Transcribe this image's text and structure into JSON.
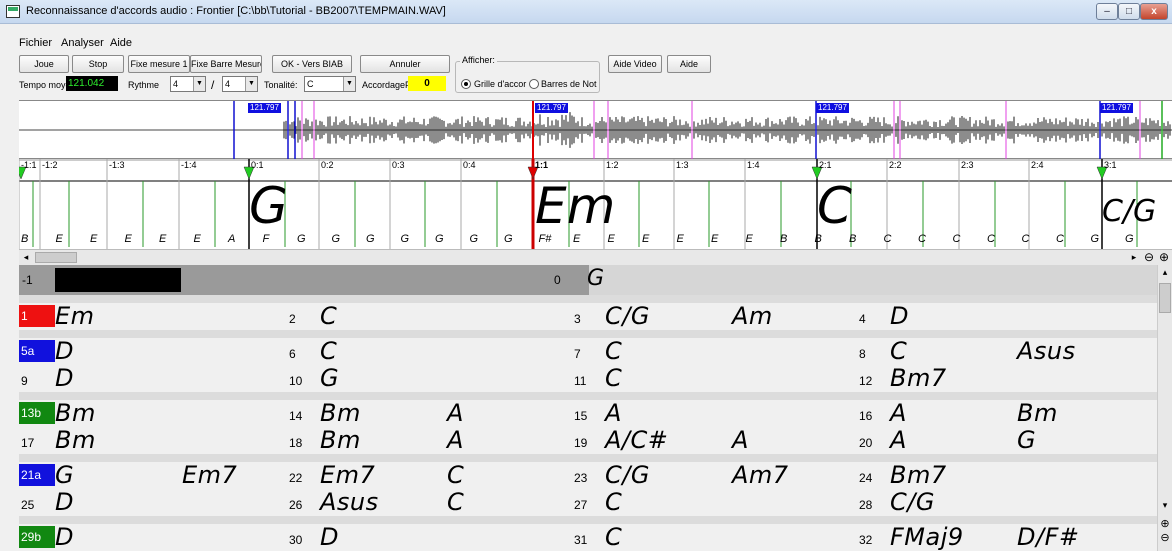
{
  "window": {
    "title": "Reconnaissance d'accords audio : Frontier [C:\\bb\\Tutorial - BB2007\\TEMPMAIN.WAV]",
    "btn_min": "–",
    "btn_max": "□",
    "btn_close": "x"
  },
  "menu": {
    "file": "Fichier",
    "analyze": "Analyser",
    "help": "Aide"
  },
  "toolbar": {
    "play": "Joue",
    "stop": "Stop",
    "fix_bar1": "Fixe mesure 1",
    "fix_barlines": "Fixe Barre Mesure",
    "ok_biab": "OK - Vers BIAB",
    "cancel": "Annuler",
    "display_group": "Afficher:",
    "help_video": "Aide Video",
    "help": "Aide",
    "tempo_label": "Tempo moyen",
    "tempo_value": "121.042",
    "rhythm_label": "Rythme",
    "rhythm_num": "4",
    "rhythm_slash": "/",
    "rhythm_den": "4",
    "key_label": "Tonalité:",
    "key_value": "C",
    "tuning_label": "AccordageF",
    "tuning_value": "0",
    "radio_grid": "Grille d'accor",
    "radio_bars": "Barres de Not"
  },
  "waveform": {
    "tempo_markers": [
      "121.797",
      "121.797",
      "121.797",
      "121.797"
    ]
  },
  "ruler": {
    "beat_labels": [
      "-1:1",
      "-1:2",
      "-1:3",
      "-1:4",
      "0:1",
      "0:2",
      "0:3",
      "0:4",
      "1:1",
      "1:2",
      "1:3",
      "1:4",
      "2:1",
      "2:2",
      "2:3",
      "2:4",
      "3:1"
    ],
    "chords": [
      "G",
      "Em",
      "C",
      "C/G"
    ],
    "notes": [
      "B",
      "E",
      "E",
      "E",
      "E",
      "E",
      "A",
      "F",
      "G",
      "G",
      "G",
      "G",
      "G",
      "G",
      "G",
      "F#",
      "E",
      "E",
      "E",
      "E",
      "E",
      "E",
      "B",
      "B",
      "B",
      "C",
      "C",
      "C",
      "C",
      "C",
      "C",
      "G",
      "G"
    ]
  },
  "grid": {
    "rows": [
      {
        "cells": [
          {
            "num": "-1",
            "chords": [
              ""
            ]
          },
          {
            "num": "0",
            "chords": [
              "G"
            ]
          }
        ]
      },
      {
        "cells": [
          {
            "num": "1",
            "badge": "#ee1111",
            "chords": [
              "Em"
            ]
          },
          {
            "num": "2",
            "chords": [
              "C"
            ]
          },
          {
            "num": "3",
            "chords": [
              "C/G",
              "Am"
            ]
          },
          {
            "num": "4",
            "chords": [
              "D"
            ]
          }
        ]
      },
      {
        "cells": [
          {
            "num": "5a",
            "badge": "#1111dd",
            "chords": [
              "D"
            ]
          },
          {
            "num": "6",
            "chords": [
              "C"
            ]
          },
          {
            "num": "7",
            "chords": [
              "C"
            ]
          },
          {
            "num": "8",
            "chords": [
              "C",
              "Asus"
            ]
          }
        ]
      },
      {
        "cells": [
          {
            "num": "9",
            "chords": [
              "D"
            ]
          },
          {
            "num": "10",
            "chords": [
              "G"
            ]
          },
          {
            "num": "11",
            "chords": [
              "C"
            ]
          },
          {
            "num": "12",
            "chords": [
              "Bm7"
            ]
          }
        ]
      },
      {
        "cells": [
          {
            "num": "13b",
            "badge": "#118811",
            "chords": [
              "Bm"
            ]
          },
          {
            "num": "14",
            "chords": [
              "Bm",
              "A"
            ]
          },
          {
            "num": "15",
            "chords": [
              "A"
            ]
          },
          {
            "num": "16",
            "chords": [
              "A",
              "Bm"
            ]
          }
        ]
      },
      {
        "cells": [
          {
            "num": "17",
            "chords": [
              "Bm"
            ]
          },
          {
            "num": "18",
            "chords": [
              "Bm",
              "A"
            ]
          },
          {
            "num": "19",
            "chords": [
              "A/C#",
              "A"
            ]
          },
          {
            "num": "20",
            "chords": [
              "A",
              "G"
            ]
          }
        ]
      },
      {
        "cells": [
          {
            "num": "21a",
            "badge": "#1111dd",
            "chords": [
              "G",
              "Em7"
            ]
          },
          {
            "num": "22",
            "chords": [
              "Em7",
              "C"
            ]
          },
          {
            "num": "23",
            "chords": [
              "C/G",
              "Am7"
            ]
          },
          {
            "num": "24",
            "chords": [
              "Bm7"
            ]
          }
        ]
      },
      {
        "cells": [
          {
            "num": "25",
            "chords": [
              "D"
            ]
          },
          {
            "num": "26",
            "chords": [
              "Asus",
              "C"
            ]
          },
          {
            "num": "27",
            "chords": [
              "C"
            ]
          },
          {
            "num": "28",
            "chords": [
              "C/G"
            ]
          }
        ]
      },
      {
        "cells": [
          {
            "num": "29b",
            "badge": "#118811",
            "chords": [
              "D"
            ]
          },
          {
            "num": "30",
            "chords": [
              "D"
            ]
          },
          {
            "num": "31",
            "chords": [
              "C"
            ]
          },
          {
            "num": "32",
            "chords": [
              "FMaj9",
              "D/F#"
            ]
          }
        ]
      }
    ]
  },
  "scroll": {
    "left_arrow": "◂",
    "right_arrow": "▸",
    "zoom_out": "⊖",
    "zoom_in": "⊕",
    "up_arrow": "▴",
    "down_arrow": "▾"
  }
}
